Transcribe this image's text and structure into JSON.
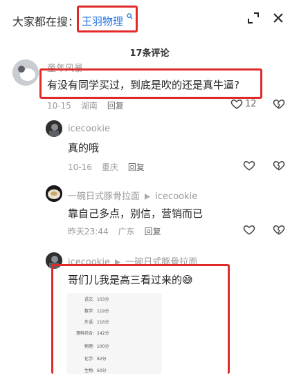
{
  "search": {
    "prefix": "大家都在搜：",
    "term": "王羽物理"
  },
  "comments_header": {
    "count_label": "17条评论"
  },
  "comments": [
    {
      "username": "童年风暴",
      "text": "有没有同学买过，到底是吹的还是真牛逼?",
      "date": "10-15",
      "location": "湖南",
      "reply_label": "回复",
      "like_count": "12"
    },
    {
      "username": "icecookie",
      "text": "真的哦",
      "date": "10-16",
      "location": "重庆",
      "reply_label": "回复"
    },
    {
      "username": "一碗日式豚骨拉面",
      "reply_to": "icecookie",
      "text": "靠自己多点，别信，营销而已",
      "date": "昨天23:44",
      "location": "广东",
      "reply_label": "回复"
    },
    {
      "username": "icecookie",
      "reply_to": "一碗日式豚骨拉面",
      "text": "哥们儿我是高三看过来的",
      "emoji": "😅"
    }
  ],
  "score_card": {
    "rows": [
      {
        "label": "语文:",
        "value": "103分"
      },
      {
        "label": "数学:",
        "value": "119分"
      },
      {
        "label": "外语:",
        "value": "116分"
      },
      {
        "label": "理科综合:",
        "value": "242分"
      },
      {
        "label": "物理:",
        "value": "100分"
      },
      {
        "label": "化学:",
        "value": "82分"
      },
      {
        "label": "生物:",
        "value": "60分"
      }
    ]
  },
  "colors": {
    "highlight": "#e02a2a",
    "link": "#1d6fe0"
  },
  "icons": [
    "search-icon",
    "expand-icon",
    "close-icon",
    "heart-icon",
    "broken-heart-icon",
    "triangle-arrow-icon"
  ]
}
